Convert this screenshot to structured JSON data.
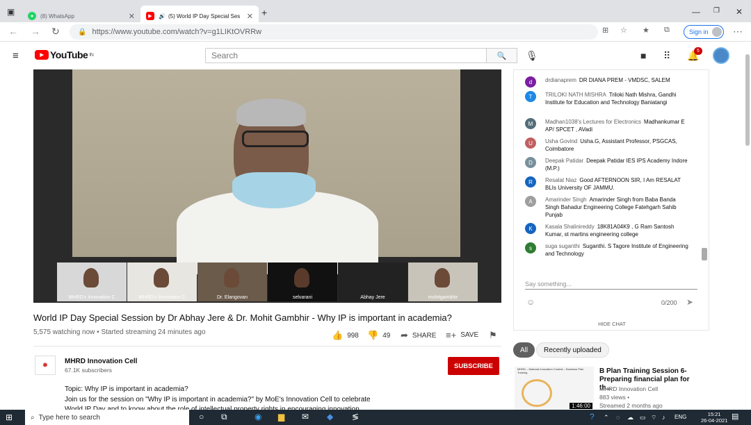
{
  "browser": {
    "tabs": [
      {
        "title": "(8) WhatsApp",
        "active": false
      },
      {
        "title": "(5) World IP Day Special Ses",
        "active": true
      }
    ],
    "new_tab": "+",
    "url": "https://www.youtube.com/watch?v=g1LIKtOVRRw",
    "signin_label": "Sign in"
  },
  "youtube": {
    "logo_text": "YouTube",
    "region": "IN",
    "search_placeholder": "Search",
    "notification_count": "5"
  },
  "video": {
    "participants": [
      "MHRD's Innovation C",
      "MHRD's Innovation C",
      "Dr. Elangovan",
      "selvarani",
      "Abhay Jere",
      "mohitgambhir"
    ],
    "title": "World IP Day Special Session by Dr Abhay Jere & Dr. Mohit Gambhir - Why IP is important in academia?",
    "meta": "5,575 watching now • Started streaming 24 minutes ago",
    "likes": "998",
    "dislikes": "49",
    "share_label": "SHARE",
    "save_label": "SAVE"
  },
  "channel": {
    "name": "MHRD Innovation Cell",
    "subscribers": "67.1K subscribers",
    "subscribe_label": "SUBSCRIBE"
  },
  "description": {
    "line1": "Topic: Why IP is important in academia?",
    "line2": "Join us for the session on \"Why IP is important in academia?\" by MoE's Innovation Cell to celebrate",
    "line3": "World IP Day and to know about the role of intellectual property rights in encouraging innovation."
  },
  "chat": {
    "messages": [
      {
        "initial": "d",
        "color": "#7b1fa2",
        "author": "drdianaprem",
        "text": "DR DIANA PREM - VMDSC, SALEM"
      },
      {
        "initial": "T",
        "color": "#1e88e5",
        "author": "TRILOKI NATH MISHRA",
        "text": "Triloki Nath Mishra, Gandhi Institute for Education and Technology Baniatangi"
      },
      {
        "initial": "M",
        "color": "#546e7a",
        "author": "Madhan1038's Lectures for Electronics",
        "text": "Madhankumar E AP/ SPCET , AVadi"
      },
      {
        "initial": "U",
        "color": "#c06060",
        "author": "Usha Govind",
        "text": "Usha.G, Assistant Professor, PSGCAS, Coimbatore"
      },
      {
        "initial": "D",
        "color": "#78909c",
        "author": "Deepak Patidar",
        "text": "Deepak Patidar IES IPS Academy Indore (M.P.)"
      },
      {
        "initial": "R",
        "color": "#1565c0",
        "author": "Resalat Niaz",
        "text": "Good AFTERNOON SIR, I Am RESALAT BLIs University OF JAMMU."
      },
      {
        "initial": "A",
        "color": "#9e9e9e",
        "author": "Amarinder Singh",
        "text": "Amarinder Singh from Baba Banda Singh Bahadur Engineering College Fatehgarh Sahib Punjab"
      },
      {
        "initial": "K",
        "color": "#1565c0",
        "author": "Kasala Shalinireddy",
        "text": "18K81A04K9 , G Ram Santosh Kumar, st martins engineering college"
      },
      {
        "initial": "s",
        "color": "#2e7d32",
        "author": "suga suganthi",
        "text": "Suganthi. S Tagore Institute of Engineering and Technology"
      }
    ],
    "input_placeholder": "Say something...",
    "char_count": "0/200",
    "hide_label": "HIDE CHAT"
  },
  "chips": [
    "All",
    "Recently uploaded"
  ],
  "recommended": {
    "thumb_header": "MHRD – National Innovation Contest – Business Plan Training",
    "duration": "1:46:00",
    "title": "B Plan Training Session 6- Preparing financial plan for th...",
    "channel": "MHRD Innovation Cell",
    "views": "883 views •",
    "time": "Streamed 2 months ago"
  },
  "taskbar": {
    "search_placeholder": "Type here to search",
    "lang": "ENG",
    "time": "15:21",
    "date": "26-04-2021"
  }
}
